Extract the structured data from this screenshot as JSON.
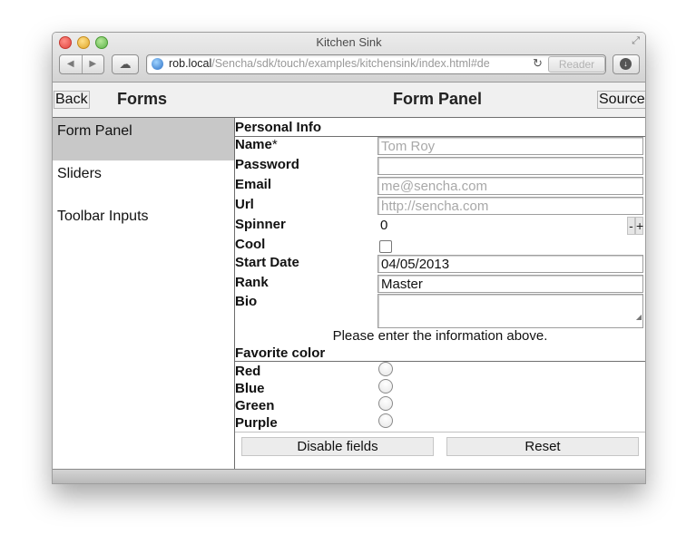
{
  "browser": {
    "window_title": "Kitchen Sink",
    "url_host": "rob.local",
    "url_path": "/Sencha/sdk/touch/examples/kitchensink/index.html#de",
    "reader_label": "Reader"
  },
  "header": {
    "back_label": "Back",
    "section_title": "Forms",
    "panel_title": "Form Panel",
    "source_label": "Source"
  },
  "sidebar": {
    "items": [
      {
        "label": "Form Panel",
        "selected": true
      },
      {
        "label": "Sliders",
        "selected": false
      },
      {
        "label": "Toolbar Inputs",
        "selected": false
      }
    ]
  },
  "form": {
    "personal_info_title": "Personal Info",
    "name_label": "Name",
    "name_required_mark": "*",
    "name_placeholder": "Tom Roy",
    "password_label": "Password",
    "password_value": "",
    "email_label": "Email",
    "email_placeholder": "me@sencha.com",
    "url_label": "Url",
    "url_placeholder": "http://sencha.com",
    "spinner_label": "Spinner",
    "spinner_value": "0",
    "spinner_minus": "-",
    "spinner_plus": "+",
    "cool_label": "Cool",
    "cool_checked": false,
    "start_date_label": "Start Date",
    "start_date_value": "04/05/2013",
    "rank_label": "Rank",
    "rank_value": "Master",
    "bio_label": "Bio",
    "bio_value": "",
    "help_text": "Please enter the information above.",
    "favorite_color_title": "Favorite color",
    "colors": [
      {
        "label": "Red",
        "checked": false
      },
      {
        "label": "Blue",
        "checked": false
      },
      {
        "label": "Green",
        "checked": false
      },
      {
        "label": "Purple",
        "checked": false
      }
    ],
    "disable_button_label": "Disable fields",
    "reset_button_label": "Reset"
  }
}
